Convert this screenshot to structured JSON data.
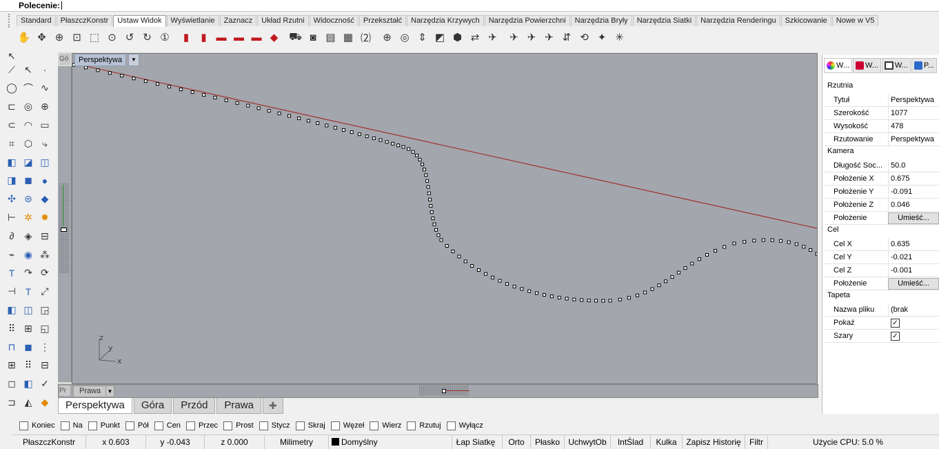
{
  "command": {
    "label": "Polecenie:"
  },
  "tabs": [
    "Standard",
    "PłaszczKonstr",
    "Ustaw Widok",
    "Wyświetlanie",
    "Zaznacz",
    "Układ Rzutni",
    "Widoczność",
    "Przekształć",
    "Narzędzia Krzywych",
    "Narzędzia Powierzchni",
    "Narzędzia Bryły",
    "Narzędzia Siatki",
    "Narzędzia Renderingu",
    "Szkicowanie",
    "Nowe w V5"
  ],
  "active_tab": "Ustaw Widok",
  "toolbar_icons": [
    "pan-icon",
    "rotate-view-icon",
    "zoom-dynamic-icon",
    "zoom-extents-icon",
    "zoom-window-icon",
    "zoom-selected-icon",
    "undo-view-icon",
    "redo-view-icon",
    "zoom-1to1-icon",
    "car-front-icon",
    "car-back-icon",
    "car-left-icon",
    "car-right-icon",
    "car-top-icon",
    "car-perspective-icon",
    "camera-set-icon",
    "camera-icon",
    "named-view-save-icon",
    "named-view-restore-icon",
    "two-point-perspective-icon",
    "target-icon",
    "target-camera-icon",
    "lens-length-icon",
    "cplane-icon",
    "view-rotate-icon",
    "swap-view-icon",
    "plan-view-icon",
    "parallel-icon",
    "perspective-icon",
    "twist-icon",
    "elevation-icon",
    "orbit-icon",
    "walkabout-icon",
    "sun-icon"
  ],
  "viewport": {
    "title": "Perspektywa",
    "top_left_label": "Gó",
    "bottom_label_short": "Pr",
    "bottom_view_name": "Prawa",
    "axes": {
      "z": "z",
      "y": "y",
      "x": "x"
    }
  },
  "viewport_tabs": [
    "Perspektywa",
    "Góra",
    "Przód",
    "Prawa"
  ],
  "active_viewport_tab": "Perspektywa",
  "osnap": [
    {
      "label": "Koniec",
      "checked": false
    },
    {
      "label": "Na",
      "checked": false
    },
    {
      "label": "Punkt",
      "checked": false
    },
    {
      "label": "Pół",
      "checked": false
    },
    {
      "label": "Cen",
      "checked": false
    },
    {
      "label": "Przec",
      "checked": false
    },
    {
      "label": "Prost",
      "checked": false
    },
    {
      "label": "Stycz",
      "checked": false
    },
    {
      "label": "Skraj",
      "checked": false
    },
    {
      "label": "Węzeł",
      "checked": false
    },
    {
      "label": "Wierz",
      "checked": false
    },
    {
      "label": "Rzutuj",
      "checked": false
    },
    {
      "label": "Wyłącz",
      "checked": false
    }
  ],
  "status": {
    "cplane": "PłaszczKonstr",
    "x": "x 0.603",
    "y": "y -0.043",
    "z": "z 0.000",
    "units": "Milimetry",
    "layer": "Domyślny",
    "toggles": [
      "Łap Siatkę",
      "Orto",
      "Płasko",
      "UchwytOb",
      "IntŚlad",
      "Kulka",
      "Zapisz Historię",
      "Filtr"
    ],
    "cpu": "Użycie CPU: 5.0 %"
  },
  "panel": {
    "tabs": [
      {
        "label": "W...",
        "icon": "color-wheel-icon"
      },
      {
        "label": "W...",
        "icon": "layer-shield-icon"
      },
      {
        "label": "W...",
        "icon": "monitor-icon"
      },
      {
        "label": "P...",
        "icon": "help-icon"
      }
    ],
    "sections": {
      "rzutnia": {
        "title": "Rzutnia",
        "rows": [
          {
            "key": "Tytuł",
            "value": "Perspektywa"
          },
          {
            "key": "Szerokość",
            "value": "1077"
          },
          {
            "key": "Wysokość",
            "value": "478"
          },
          {
            "key": "Rzutowanie",
            "value": "Perspektywa"
          }
        ]
      },
      "kamera": {
        "title": "Kamera",
        "rows": [
          {
            "key": "Długość Soc...",
            "value": "50.0"
          },
          {
            "key": "Położenie X",
            "value": "0.675"
          },
          {
            "key": "Położenie Y",
            "value": "-0.091"
          },
          {
            "key": "Położenie Z",
            "value": "0.046"
          },
          {
            "key": "Położenie",
            "button": "Umieść..."
          }
        ]
      },
      "cel": {
        "title": "Cel",
        "rows": [
          {
            "key": "Cel X",
            "value": "0.635"
          },
          {
            "key": "Cel Y",
            "value": "-0.021"
          },
          {
            "key": "Cel Z",
            "value": "-0.001"
          },
          {
            "key": "Położenie",
            "button": "Umieść..."
          }
        ]
      },
      "tapeta": {
        "title": "Tapeta",
        "rows": [
          {
            "key": "Nazwa pliku",
            "value": "(brak"
          },
          {
            "key": "Pokaż",
            "checked": true
          },
          {
            "key": "Szary",
            "checked": true
          }
        ]
      }
    }
  },
  "colors": {
    "viewport_bg": "#a3a6ac",
    "axis_red": "#a0302e",
    "title_bg": "#b7c2d5"
  }
}
